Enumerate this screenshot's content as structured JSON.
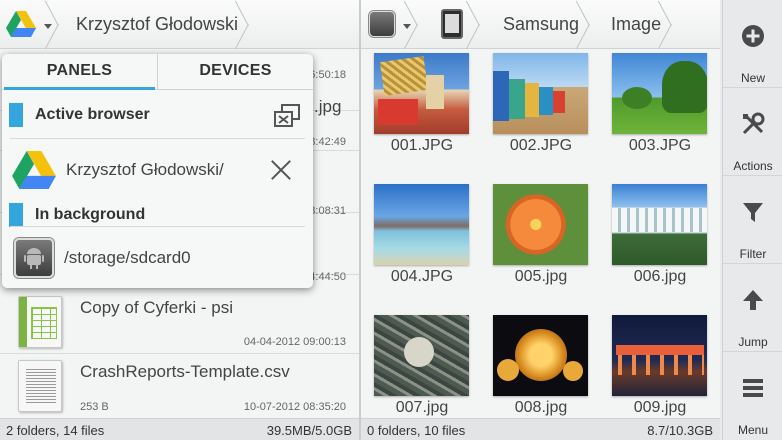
{
  "left_pane": {
    "breadcrumb": {
      "location": "Krzysztof Głodowski"
    },
    "files": [
      {
        "name": "",
        "date": "6:50:18"
      },
      {
        "name": ".jpg",
        "date": "8:42:49"
      },
      {
        "name": "",
        "date": "8:08:31"
      },
      {
        "name": "",
        "date": "4:44:50"
      },
      {
        "name": "Copy of Cyferki - psi",
        "date": "04-04-2012 09:00:13",
        "icon": "spreadsheet-icon"
      },
      {
        "name": "CrashReports-Template.csv",
        "size": "253 B",
        "date": "10-07-2012 08:35:20",
        "icon": "text-file-icon"
      }
    ],
    "status": {
      "counts": "2 folders, 14 files",
      "storage": "39.5MB/5.0GB"
    }
  },
  "panels_popup": {
    "tabs": [
      "PANELS",
      "DEVICES"
    ],
    "active_tab": "PANELS",
    "active_browser_label": "Active browser",
    "active_item": "Krzysztof Głodowski/",
    "background_label": "In background",
    "background_item": "/storage/sdcard0"
  },
  "right_pane": {
    "breadcrumb": [
      "Samsung",
      "Image"
    ],
    "thumbnails": [
      {
        "label": "001.JPG"
      },
      {
        "label": "002.JPG"
      },
      {
        "label": "003.JPG"
      },
      {
        "label": "004.JPG"
      },
      {
        "label": "005.jpg"
      },
      {
        "label": "006.jpg"
      },
      {
        "label": "007.jpg"
      },
      {
        "label": "008.jpg"
      },
      {
        "label": "009.jpg"
      }
    ],
    "status": {
      "counts": "0 folders, 10 files",
      "storage": "8.7/10.3GB"
    }
  },
  "action_bar": [
    {
      "label": "New",
      "icon": "plus-circle-icon"
    },
    {
      "label": "Actions",
      "icon": "tools-icon"
    },
    {
      "label": "Filter",
      "icon": "filter-icon"
    },
    {
      "label": "Jump",
      "icon": "arrow-up-icon"
    },
    {
      "label": "Menu",
      "icon": "menu-icon"
    }
  ],
  "colors": {
    "accent": "#35a6dd",
    "background": "#f3f4f4"
  }
}
